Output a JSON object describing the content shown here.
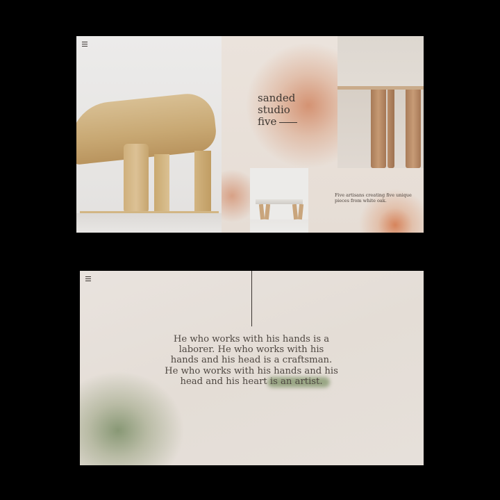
{
  "slide1": {
    "menu_icon": "hamburger-menu-icon",
    "brand": {
      "line1": "sanded",
      "line2": "studio",
      "line3": "five"
    },
    "tagline": "Five artisans creating five unique pieces from white oak.",
    "images": {
      "chair": "wooden chair close-up",
      "table": "oak table legs",
      "bench": "oak bench"
    }
  },
  "slide2": {
    "menu_icon": "hamburger-menu-icon",
    "quote_main": "He who works with his hands is a laborer. He who works with his hands and his head is a craftsman. He who works with his hands and his head and his heart",
    "quote_highlight": "is an artist."
  },
  "colors": {
    "accent_terracotta": "#d4744a",
    "accent_sage": "#80946a",
    "text": "#3d3631"
  }
}
